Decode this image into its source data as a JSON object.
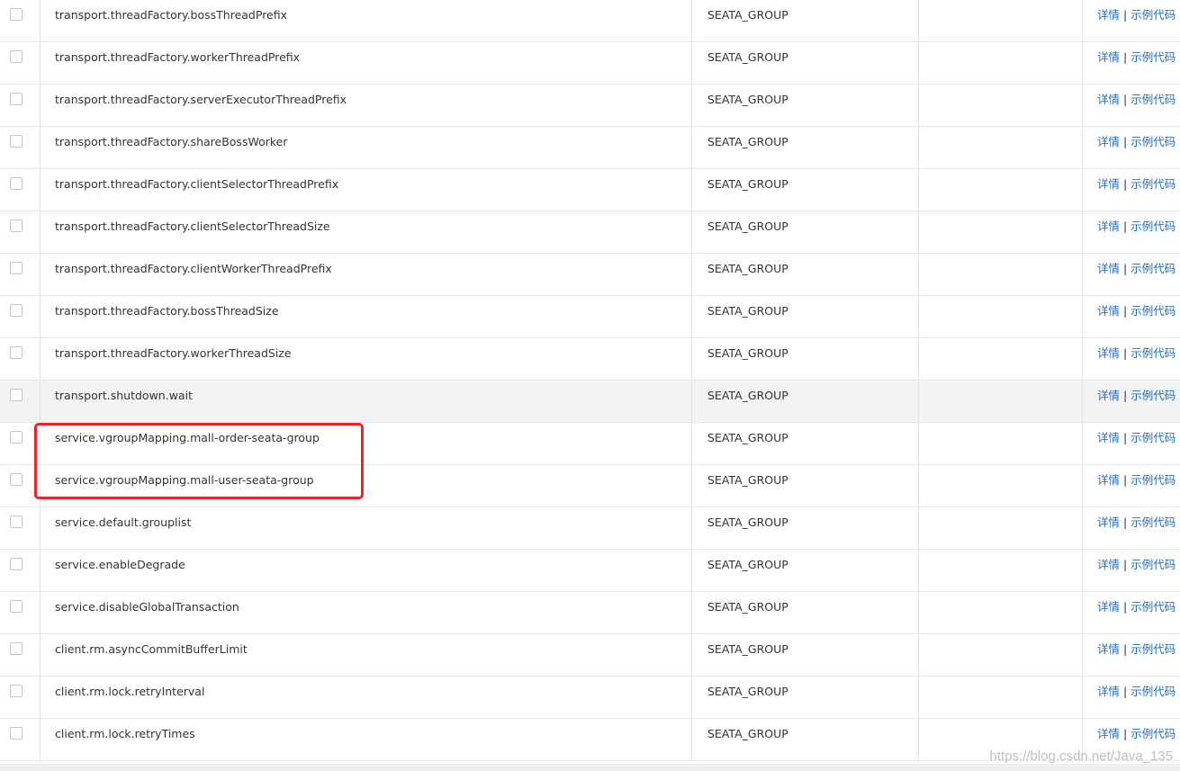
{
  "table": {
    "rows": [
      {
        "data_id": "transport.threadFactory.bossThreadPrefix",
        "group": "SEATA_GROUP",
        "app": ""
      },
      {
        "data_id": "transport.threadFactory.workerThreadPrefix",
        "group": "SEATA_GROUP",
        "app": ""
      },
      {
        "data_id": "transport.threadFactory.serverExecutorThreadPrefix",
        "group": "SEATA_GROUP",
        "app": ""
      },
      {
        "data_id": "transport.threadFactory.shareBossWorker",
        "group": "SEATA_GROUP",
        "app": ""
      },
      {
        "data_id": "transport.threadFactory.clientSelectorThreadPrefix",
        "group": "SEATA_GROUP",
        "app": ""
      },
      {
        "data_id": "transport.threadFactory.clientSelectorThreadSize",
        "group": "SEATA_GROUP",
        "app": ""
      },
      {
        "data_id": "transport.threadFactory.clientWorkerThreadPrefix",
        "group": "SEATA_GROUP",
        "app": ""
      },
      {
        "data_id": "transport.threadFactory.bossThreadSize",
        "group": "SEATA_GROUP",
        "app": ""
      },
      {
        "data_id": "transport.threadFactory.workerThreadSize",
        "group": "SEATA_GROUP",
        "app": ""
      },
      {
        "data_id": "transport.shutdown.wait",
        "group": "SEATA_GROUP",
        "app": ""
      },
      {
        "data_id": "service.vgroupMapping.mall-order-seata-group",
        "group": "SEATA_GROUP",
        "app": ""
      },
      {
        "data_id": "service.vgroupMapping.mall-user-seata-group",
        "group": "SEATA_GROUP",
        "app": ""
      },
      {
        "data_id": "service.default.grouplist",
        "group": "SEATA_GROUP",
        "app": ""
      },
      {
        "data_id": "service.enableDegrade",
        "group": "SEATA_GROUP",
        "app": ""
      },
      {
        "data_id": "service.disableGlobalTransaction",
        "group": "SEATA_GROUP",
        "app": ""
      },
      {
        "data_id": "client.rm.asyncCommitBufferLimit",
        "group": "SEATA_GROUP",
        "app": ""
      },
      {
        "data_id": "client.rm.lock.retryInterval",
        "group": "SEATA_GROUP",
        "app": ""
      },
      {
        "data_id": "client.rm.lock.retryTimes",
        "group": "SEATA_GROUP",
        "app": ""
      }
    ]
  },
  "ops": {
    "detail_label": "详情",
    "separator": "|",
    "sample_code_label": "示例代码"
  },
  "watermark": "https://blog.csdn.net/Java_135",
  "colors": {
    "link": "#1f6ebf",
    "highlight_border": "#e5242b",
    "hover_row": "#f2f3f5",
    "border": "#e6e6e6"
  }
}
